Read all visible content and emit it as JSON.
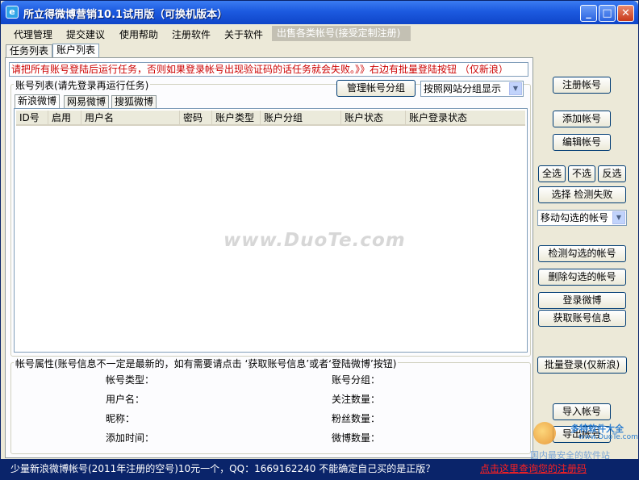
{
  "window": {
    "title": "所立得微博营销10.1试用版（可换机版本）",
    "icon_letter": "e",
    "minimize": "_",
    "maximize": "□",
    "close": "✕"
  },
  "menu": {
    "items": [
      "代理管理",
      "提交建议",
      "使用帮助",
      "注册软件",
      "关于软件"
    ],
    "special": "出售各类帐号(接受定制注册)"
  },
  "main_tabs": [
    "任务列表",
    "账户列表"
  ],
  "warning": "请把所有账号登陆后运行任务，否则如果登录帐号出现验证码的话任务就会失败。》》右边有批量登陆按钮 （仅新浪）",
  "account_list": {
    "legend": "账号列表(请先登录再运行任务)",
    "manage_group_button": "管理帐号分组",
    "display_mode": "按照网站分组显示",
    "tabs": [
      "新浪微博",
      "网易微博",
      "搜狐微博"
    ],
    "columns": [
      "ID号",
      "启用",
      "用户名",
      "密码",
      "账户类型",
      "账户分组",
      "账户状态",
      "账户登录状态"
    ]
  },
  "right_panel": {
    "register": "注册帐号",
    "add": "添加帐号",
    "edit": "编辑帐号",
    "select_all": "全选",
    "select_none": "不选",
    "invert": "反选",
    "select_failed": "选择 检测失败",
    "move_checked": "移动勾选的帐号",
    "check_checked": "检测勾选的帐号",
    "delete_checked": "删除勾选的帐号",
    "login_weibo": "登录微博",
    "get_info": "获取账号信息",
    "batch_login": "批量登录(仅新浪)",
    "import": "导入帐号",
    "export": "导出帐号"
  },
  "properties": {
    "legend": "帐号属性(账号信息不一定是最新的，如有需要请点击  ‘获取账号信息’或者‘登陆微博’按钮)",
    "account_type": "帐号类型：",
    "username": "用户名：",
    "nickname": "昵称：",
    "added_time": "添加时间：",
    "account_group": "账号分组：",
    "following": "关注数量：",
    "fans": "粉丝数量：",
    "weibo_count": "微博数量："
  },
  "status": {
    "text": "少量新浪微博帐号(2011年注册的空号)10元一个，QQ：1669162240 不能确定自己买的是正版？",
    "link": "点击这里查询您的注册码"
  },
  "watermarks": {
    "duote": "www.DuoTe.com",
    "site_name": "多特软件大全",
    "site_url": "www.DuoTe.com",
    "slogan": "国内最安全的软件站"
  }
}
